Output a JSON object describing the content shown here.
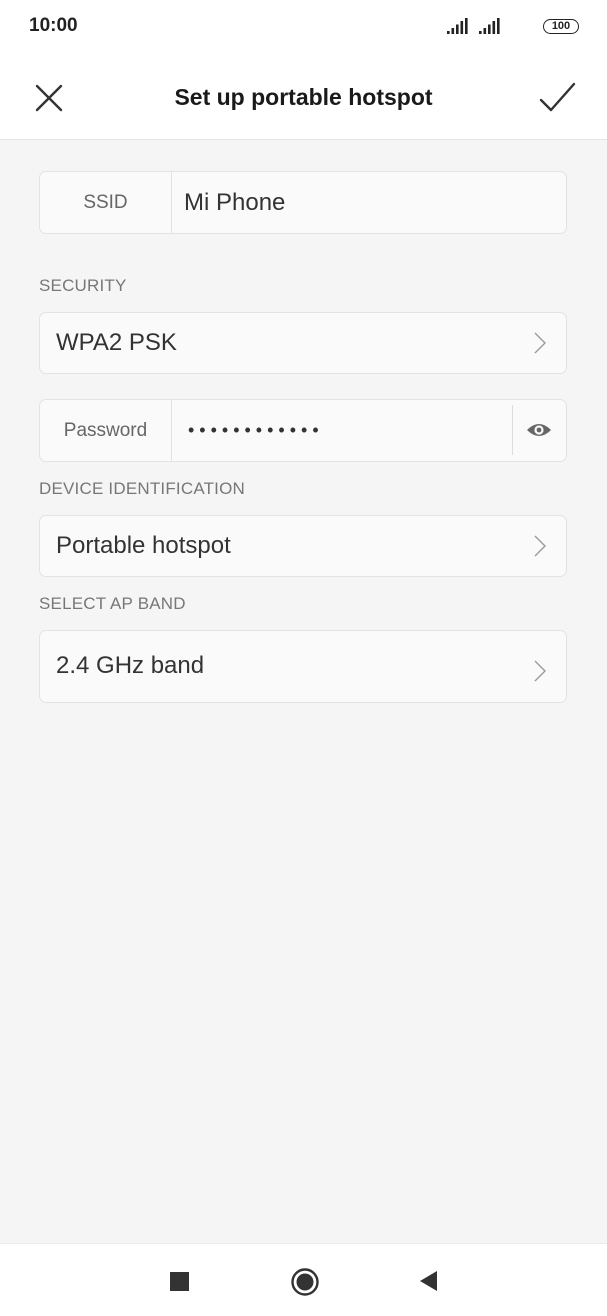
{
  "status_bar": {
    "time": "10:00",
    "battery_level": "100",
    "signal_icons": [
      "signal-strength-icon",
      "signal-strength-icon"
    ]
  },
  "header": {
    "title": "Set up portable hotspot",
    "close_icon": "close-icon",
    "confirm_icon": "check-icon"
  },
  "ssid": {
    "label": "SSID",
    "value": "Mi Phone"
  },
  "security": {
    "section_label": "SECURITY",
    "value": "WPA2 PSK"
  },
  "password": {
    "label": "Password",
    "masked_value": "••••••••••••",
    "toggle_icon": "eye-icon"
  },
  "device_identification": {
    "section_label": "DEVICE IDENTIFICATION",
    "value": "Portable hotspot"
  },
  "ap_band": {
    "section_label": "SELECT AP BAND",
    "value": "2.4 GHz band"
  },
  "nav_bar": {
    "recents_icon": "square-icon",
    "home_icon": "circle-icon",
    "back_icon": "triangle-back-icon"
  },
  "colors": {
    "background": "#f5f5f5",
    "card": "#fafafa",
    "text": "#333333",
    "section_label": "#777777"
  }
}
